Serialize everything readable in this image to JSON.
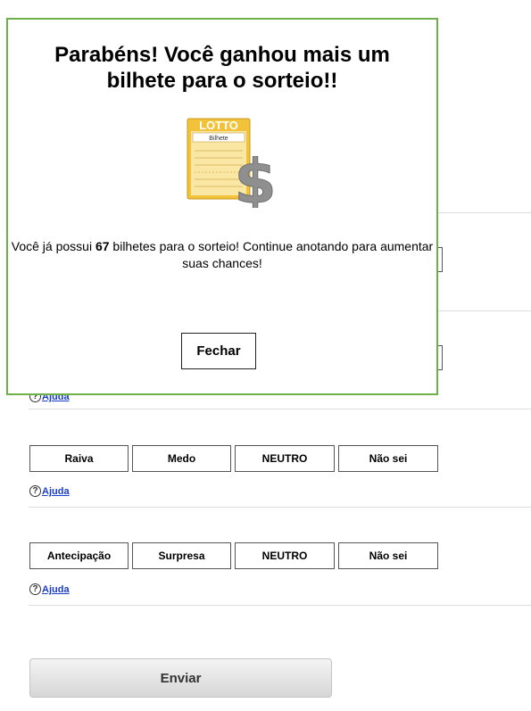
{
  "modal": {
    "title": "Parabéns! Você ganhou mais um bilhete para o sorteio!!",
    "ticket_image": {
      "brand": "LOTTO",
      "label": "Bilhete",
      "colors": {
        "ticket": "#f2c23a",
        "dollar": "#9a9a9a"
      }
    },
    "message_prefix": "Você já possui ",
    "ticket_count": "67",
    "message_suffix": " bilhetes para o sorteio! Continue anotando para aumentar suas chances!",
    "close_label": "Fechar",
    "border_color": "#6db04a"
  },
  "questions": [
    {
      "options": [
        "Raiva",
        "Medo",
        "NEUTRO",
        "Não sei"
      ],
      "help_label": "Ajuda"
    },
    {
      "options": [
        "Antecipação",
        "Surpresa",
        "NEUTRO",
        "Não sei"
      ],
      "help_label": "Ajuda"
    }
  ],
  "partial_help_label": "Ajuda",
  "submit_label": "Enviar",
  "help_icon": "question-circle-icon"
}
